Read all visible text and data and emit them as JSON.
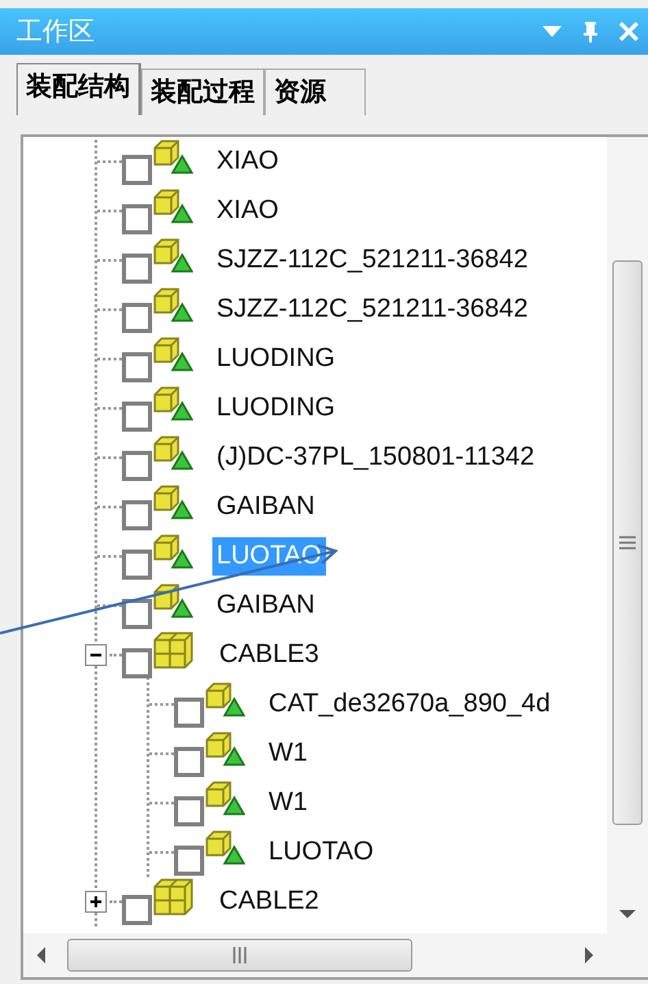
{
  "window": {
    "title": "工作区"
  },
  "tabs": [
    {
      "label": "装配结构",
      "selected": true
    },
    {
      "label": "装配过程",
      "selected": false
    },
    {
      "label": "资源",
      "selected": false
    }
  ],
  "tree": {
    "items": [
      {
        "kind": "part",
        "label": "XIAO",
        "checked": false,
        "selected": false
      },
      {
        "kind": "part",
        "label": "XIAO",
        "checked": false,
        "selected": false
      },
      {
        "kind": "part",
        "label": "SJZZ-112C_521211-36842",
        "checked": false,
        "selected": false
      },
      {
        "kind": "part",
        "label": "SJZZ-112C_521211-36842",
        "checked": false,
        "selected": false
      },
      {
        "kind": "part",
        "label": "LUODING",
        "checked": false,
        "selected": false
      },
      {
        "kind": "part",
        "label": "LUODING",
        "checked": false,
        "selected": false
      },
      {
        "kind": "part",
        "label": "(J)DC-37PL_150801-11342",
        "checked": false,
        "selected": false
      },
      {
        "kind": "part",
        "label": "GAIBAN",
        "checked": false,
        "selected": false
      },
      {
        "kind": "part",
        "label": "LUOTAO",
        "checked": false,
        "selected": true
      },
      {
        "kind": "part",
        "label": "GAIBAN",
        "checked": false,
        "selected": false
      },
      {
        "kind": "assembly",
        "label": "CABLE3",
        "checked": false,
        "selected": false,
        "expanded": true,
        "children": [
          {
            "kind": "part",
            "label": "CAT_de32670a_890_4d",
            "checked": false,
            "selected": false
          },
          {
            "kind": "part",
            "label": "W1",
            "checked": false,
            "selected": false
          },
          {
            "kind": "part",
            "label": "W1",
            "checked": false,
            "selected": false
          },
          {
            "kind": "part",
            "label": "LUOTAO",
            "checked": false,
            "selected": false
          }
        ]
      },
      {
        "kind": "assembly",
        "label": "CABLE2",
        "checked": false,
        "selected": false,
        "expanded": false
      }
    ]
  },
  "annotation": {
    "kind": "arrow"
  }
}
